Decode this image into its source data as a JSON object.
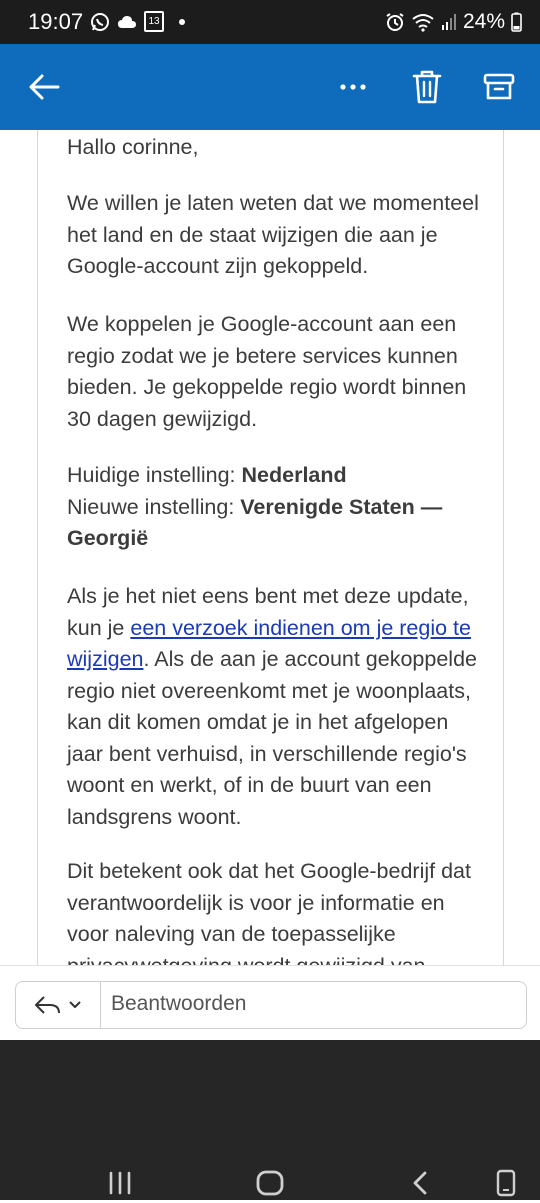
{
  "status_bar": {
    "time": "19:07",
    "battery": "24%",
    "calendar_day": "13",
    "left_icons": [
      "whatsapp-icon",
      "cloud-icon",
      "calendar-icon",
      "dot-icon"
    ],
    "right_icons": [
      "alarm-icon",
      "wifi-icon",
      "signal-icon",
      "battery-icon"
    ]
  },
  "app_bar": {
    "color": "#0f6cbd",
    "more_label": "···"
  },
  "email": {
    "greeting": "Hallo corinne,",
    "p1": "We willen je laten weten dat we momenteel het land en de staat wijzigen die aan je Google-account zijn gekoppeld.",
    "p2": "We koppelen je Google-account aan een regio zodat we je betere services kunnen bieden. Je gekoppelde regio wordt binnen 30 dagen gewijzigd.",
    "current_label": "Huidige instelling: ",
    "current_value": "Nederland",
    "new_label": "Nieuwe instelling: ",
    "new_value": "Verenigde Staten — Georgië",
    "p4_before": "Als je het niet eens bent met deze update, kun je ",
    "p4_link": "een verzoek indienen om je regio te wijzigen",
    "p4_after": ". Als de aan je account gekoppelde regio niet overeenkomt met je woonplaats, kan dit komen omdat je in het afgelopen jaar bent verhuisd, in verschillende regio's woont en werkt, of in de buurt van een landsgrens woont.",
    "p5": "Dit betekent ook dat het Google-bedrijf dat verantwoordelijk is voor je informatie en voor naleving van de toepasselijke privacywetgeving wordt gewijzigd van"
  },
  "reply": {
    "placeholder": "Beantwoorden"
  }
}
